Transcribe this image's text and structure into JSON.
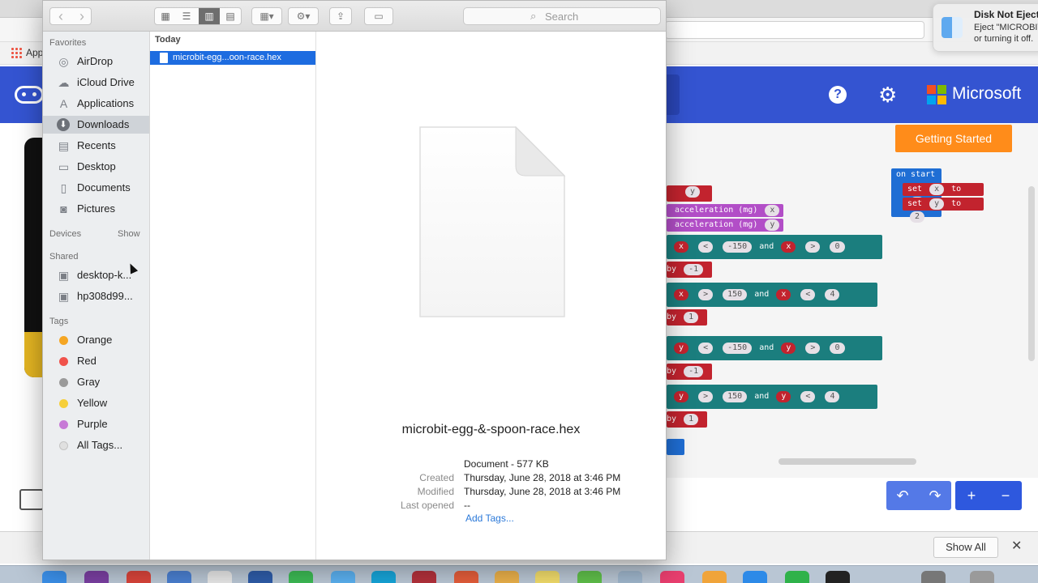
{
  "browser": {
    "bookmarks_label": "Apps"
  },
  "makecode": {
    "brand": "Microsoft",
    "getting_started": "Getting Started",
    "help_symbol": "?",
    "gear_symbol": "⚙",
    "undo_symbol": "↶",
    "redo_symbol": "↷",
    "zoom_in_symbol": "+",
    "zoom_out_symbol": "−",
    "blocks": {
      "on_start": "on start",
      "set_x": "set",
      "var_x": "x",
      "var_y": "y",
      "to": "to",
      "value_2": "2",
      "acceleration_x": "acceleration (mg)",
      "acceleration_y": "acceleration (mg)",
      "lt": "<",
      "gt": ">",
      "and": "and",
      "neg150": "-150",
      "pos150": "150",
      "zero": "0",
      "four": "4",
      "by": "by",
      "neg1": "-1",
      "one": "1"
    },
    "colors": {
      "header": "#3454d1",
      "getting_started": "#ff8c1a",
      "control_blue": "#2e58de"
    }
  },
  "notification": {
    "title": "Disk Not Ejected",
    "body_line1": "Eject \"MICROBIT\" before",
    "body_line2": "or turning it off."
  },
  "download_bar": {
    "show_all": "Show All",
    "close_symbol": "✕"
  },
  "finder": {
    "toolbar": {
      "back_symbol": "‹",
      "forward_symbol": "›",
      "search_placeholder": "Search",
      "search_symbol": "⌕"
    },
    "sidebar": {
      "favorites_heading": "Favorites",
      "favorites": [
        {
          "label": "AirDrop",
          "icon": "airdrop-icon"
        },
        {
          "label": "iCloud Drive",
          "icon": "cloud-icon"
        },
        {
          "label": "Applications",
          "icon": "applications-icon"
        },
        {
          "label": "Downloads",
          "icon": "downloads-icon",
          "selected": true
        },
        {
          "label": "Recents",
          "icon": "recents-icon"
        },
        {
          "label": "Desktop",
          "icon": "desktop-icon"
        },
        {
          "label": "Documents",
          "icon": "documents-icon"
        },
        {
          "label": "Pictures",
          "icon": "pictures-icon"
        }
      ],
      "devices_heading": "Devices",
      "devices_show": "Show",
      "shared_heading": "Shared",
      "shared": [
        {
          "label": "desktop-k...",
          "icon": "computer-icon"
        },
        {
          "label": "hp308d99...",
          "icon": "computer-icon"
        }
      ],
      "tags_heading": "Tags",
      "tags": [
        {
          "label": "Orange",
          "color": "#f5a623"
        },
        {
          "label": "Red",
          "color": "#f0524b"
        },
        {
          "label": "Gray",
          "color": "#9a9a9a"
        },
        {
          "label": "Yellow",
          "color": "#f6cf3a"
        },
        {
          "label": "Purple",
          "color": "#c77ad6"
        },
        {
          "label": "All Tags...",
          "color": "#e0e0e0"
        }
      ]
    },
    "column": {
      "heading": "Today",
      "file_label": "microbit-egg...oon-race.hex"
    },
    "preview": {
      "file_name": "microbit-egg-&-spoon-race.hex",
      "kind_size": "Document - 577 KB",
      "created_label": "Created",
      "created_value": "Thursday, June 28, 2018 at 3:46 PM",
      "modified_label": "Modified",
      "modified_value": "Thursday, June 28, 2018 at 3:46 PM",
      "last_opened_label": "Last opened",
      "last_opened_value": "--",
      "add_tags": "Add Tags..."
    }
  }
}
